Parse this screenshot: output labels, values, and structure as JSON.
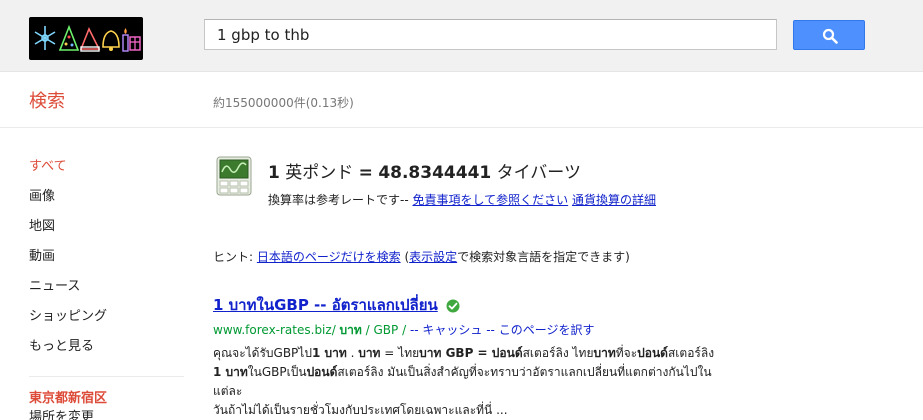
{
  "search": {
    "query": "1 gbp to thb"
  },
  "subheader": {
    "title": "検索",
    "stats": "約155000000件(0.13秒)"
  },
  "nav": {
    "items": [
      {
        "label": "すべて",
        "active": true
      },
      {
        "label": "画像"
      },
      {
        "label": "地図"
      },
      {
        "label": "動画"
      },
      {
        "label": "ニュース"
      },
      {
        "label": "ショッピング"
      },
      {
        "label": "もっと見る"
      }
    ],
    "location_title": "東京都新宿区",
    "location_change": "場所を変更"
  },
  "converter": {
    "from_amount": "1",
    "from_unit": "英ポンド",
    "equals": "=",
    "to_amount": "48.8344441",
    "to_unit": "タイバーツ",
    "note_prefix": "換算率は参考レートです-- ",
    "disclaimer_link": "免責事項をして参照ください",
    "details_link": "通貨換算の詳細"
  },
  "hint": {
    "prefix": "ヒント: ",
    "link1": "日本語のページだけを検索",
    "middle": " (",
    "link2": "表示設定",
    "suffix": "で検索対象言語を指定できます)"
  },
  "result": {
    "title": "1 บาทในGBP -- อัตราแลกเปลี่ยน",
    "url_prefix": "www.forex-rates.biz/ ",
    "url_b1": "บาท",
    "url_mid": " / GBP /",
    "url_links": "-- キャッシュ -- このページを訳す",
    "snippet_1a": "คุณจะได้รับGBPไป",
    "snippet_1b": "1 บาท",
    "snippet_1c": " . ",
    "snippet_1d": "บาท",
    "snippet_1e": " = ไทย",
    "snippet_1f": "บาท GBP = ปอนด์",
    "snippet_1g": "สเตอร์ลิง ไทย",
    "snippet_1h": "บาท",
    "snippet_1i": "ที่จะ",
    "snippet_1j": "ปอนด์",
    "snippet_1k": "สเตอร์ลิง",
    "snippet_2a": "1 บาท",
    "snippet_2b": "ในGBPเป็น",
    "snippet_2c": "ปอนด์",
    "snippet_2d": "สเตอร์ลิง มันเป็นสิ่งสำคัญที่จะทราบว่าอัตราแลกเปลี่ยนที่แตกต่างกันไปในแต่ละ",
    "snippet_3": "วันถ้าไม่ได้เป็นรายชั่วโมงกับประเทศโดยเฉพาะและที่นี่ ..."
  },
  "colors": {
    "accent_red": "#dd4b39",
    "link_blue": "#1122cc",
    "url_green": "#009933",
    "button_blue": "#4d90fe"
  }
}
